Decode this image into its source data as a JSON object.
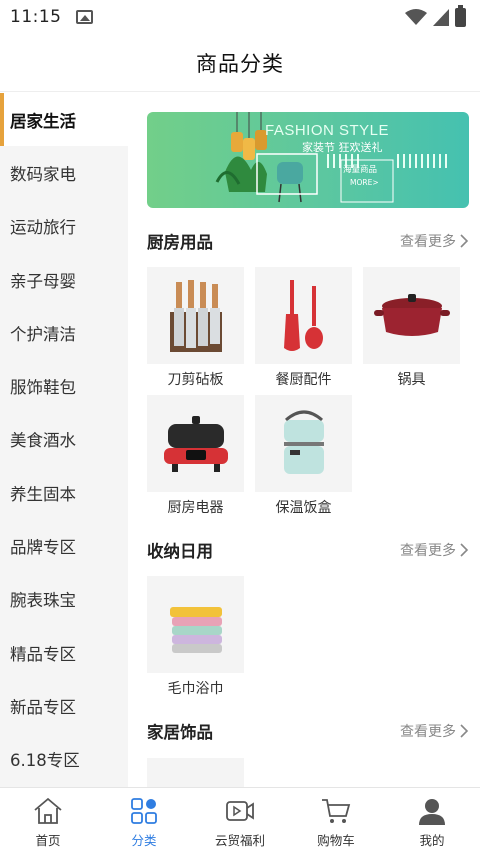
{
  "status_bar": {
    "time": "11:15"
  },
  "header": {
    "title": "商品分类"
  },
  "sidebar": {
    "items": [
      {
        "label": "居家生活",
        "active": true
      },
      {
        "label": "数码家电"
      },
      {
        "label": "运动旅行"
      },
      {
        "label": "亲子母婴"
      },
      {
        "label": "个护清洁"
      },
      {
        "label": "服饰鞋包"
      },
      {
        "label": "美食酒水"
      },
      {
        "label": "养生固本"
      },
      {
        "label": "品牌专区"
      },
      {
        "label": "腕表珠宝"
      },
      {
        "label": "精品专区"
      },
      {
        "label": "新品专区"
      },
      {
        "label": "6.18专区"
      }
    ]
  },
  "banner": {
    "title": "FASHION STYLE",
    "subtitle": "家装节 狂欢送礼",
    "tag": "海量商品",
    "more": "MORE>"
  },
  "sections": [
    {
      "title": "厨房用品",
      "more": "查看更多",
      "products": [
        {
          "name": "刀剪砧板",
          "icon": "knife-set-icon"
        },
        {
          "name": "餐厨配件",
          "icon": "spatula-icon"
        },
        {
          "name": "锅具",
          "icon": "pot-icon"
        },
        {
          "name": "厨房电器",
          "icon": "electric-pan-icon"
        },
        {
          "name": "保温饭盒",
          "icon": "lunchbox-icon"
        }
      ]
    },
    {
      "title": "收纳日用",
      "more": "查看更多",
      "products": [
        {
          "name": "毛巾浴巾",
          "icon": "towel-icon"
        }
      ]
    },
    {
      "title": "家居饰品",
      "more": "查看更多",
      "products": []
    }
  ],
  "tabbar": {
    "items": [
      {
        "label": "首页",
        "icon": "home-icon"
      },
      {
        "label": "分类",
        "icon": "category-icon",
        "active": true
      },
      {
        "label": "云贸福利",
        "icon": "video-icon"
      },
      {
        "label": "购物车",
        "icon": "cart-icon"
      },
      {
        "label": "我的",
        "icon": "user-icon"
      }
    ]
  },
  "colors": {
    "accent": "#2f7de1",
    "active_marker": "#e6a23c",
    "sidebar_bg": "#f5f5f5"
  }
}
